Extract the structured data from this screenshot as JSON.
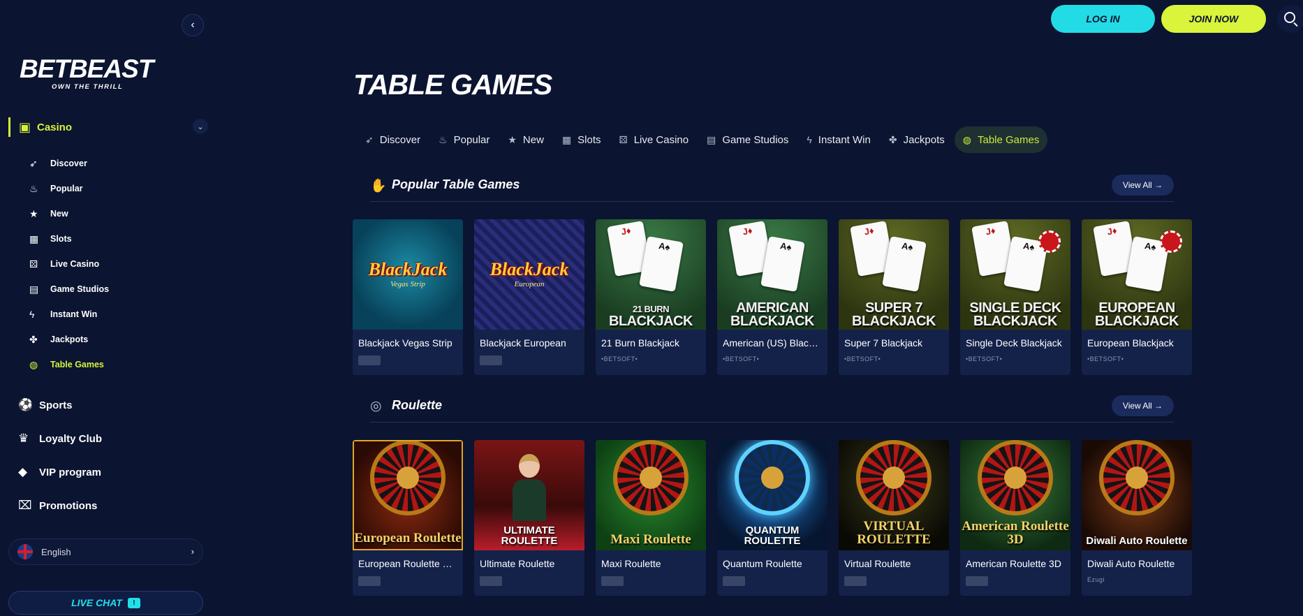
{
  "sidebar": {
    "logo_brand": "BETBEAST",
    "logo_tagline": "OWN THE THRILL",
    "casino_label": "Casino",
    "sub_items": [
      {
        "label": "Discover",
        "icon": "rocket-icon"
      },
      {
        "label": "Popular",
        "icon": "flame-icon"
      },
      {
        "label": "New",
        "icon": "star-icon"
      },
      {
        "label": "Slots",
        "icon": "slot-machine-icon"
      },
      {
        "label": "Live Casino",
        "icon": "dice-icon"
      },
      {
        "label": "Game Studios",
        "icon": "studio-icon"
      },
      {
        "label": "Instant Win",
        "icon": "lightning-icon"
      },
      {
        "label": "Jackpots",
        "icon": "clover-icon"
      },
      {
        "label": "Table Games",
        "icon": "chips-icon"
      }
    ],
    "main_items": [
      {
        "label": "Sports",
        "icon": "soccer-ball-icon"
      },
      {
        "label": "Loyalty Club",
        "icon": "crown-icon"
      },
      {
        "label": "VIP program",
        "icon": "diamond-icon"
      },
      {
        "label": "Promotions",
        "icon": "gift-icon"
      }
    ],
    "language": "English",
    "live_chat": "LIVE CHAT"
  },
  "header": {
    "login": "LOG IN",
    "join": "JOIN NOW"
  },
  "page_title": "TABLE GAMES",
  "tabs": [
    {
      "label": "Discover",
      "icon": "rocket-icon"
    },
    {
      "label": "Popular",
      "icon": "flame-icon"
    },
    {
      "label": "New",
      "icon": "star-icon"
    },
    {
      "label": "Slots",
      "icon": "slot-machine-icon"
    },
    {
      "label": "Live Casino",
      "icon": "dice-icon"
    },
    {
      "label": "Game Studios",
      "icon": "studio-icon"
    },
    {
      "label": "Instant Win",
      "icon": "lightning-icon"
    },
    {
      "label": "Jackpots",
      "icon": "clover-icon"
    },
    {
      "label": "Table Games",
      "icon": "chips-icon"
    }
  ],
  "sections": {
    "popular": {
      "title": "Popular Table Games",
      "view_all": "View All →",
      "games": [
        {
          "name": "Blackjack Vegas Strip",
          "provider": ""
        },
        {
          "name": "Blackjack European",
          "provider": ""
        },
        {
          "name": "21 Burn Blackjack",
          "provider": "•BETSOFT•",
          "art_small": "21 BURN",
          "art_big": "BLACKJACK"
        },
        {
          "name": "American (US) Blackj...",
          "provider": "•BETSOFT•",
          "art_small": "AMERICAN",
          "art_big": "BLACKJACK"
        },
        {
          "name": "Super 7 Blackjack",
          "provider": "•BETSOFT•",
          "art_small": "SUPER 7",
          "art_big": "BLACKJACK"
        },
        {
          "name": "Single Deck Blackjack",
          "provider": "•BETSOFT•",
          "art_small": "SINGLE DECK",
          "art_big": "BLACKJACK"
        },
        {
          "name": "European Blackjack",
          "provider": "•BETSOFT•",
          "art_small": "EUROPEAN",
          "art_big": "BLACKJACK"
        }
      ],
      "art_vegas_logo": "BlackJack",
      "art_vegas_sub": "Vegas Strip",
      "art_euro_logo": "BlackJack",
      "art_euro_sub": "European"
    },
    "roulette": {
      "title": "Roulette",
      "view_all": "View All →",
      "games": [
        {
          "name": "European Roulette Ch...",
          "art": "European Roulette"
        },
        {
          "name": "Ultimate Roulette",
          "art": "ULTIMATE ROULETTE"
        },
        {
          "name": "Maxi Roulette",
          "art": "Maxi Roulette"
        },
        {
          "name": "Quantum Roulette",
          "art": "QUANTUM ROULETTE"
        },
        {
          "name": "Virtual Roulette",
          "art": "VIRTUAL ROULETTE"
        },
        {
          "name": "American Roulette 3D",
          "art": "American Roulette 3D"
        },
        {
          "name": "Diwali Auto Roulette",
          "art": "Diwali Auto Roulette"
        }
      ],
      "provider_last": "Ezugi"
    }
  },
  "colors": {
    "background": "#0b1430",
    "accent_lime": "#d9f43a",
    "accent_cyan": "#22dbe5",
    "card": "#14224a"
  }
}
